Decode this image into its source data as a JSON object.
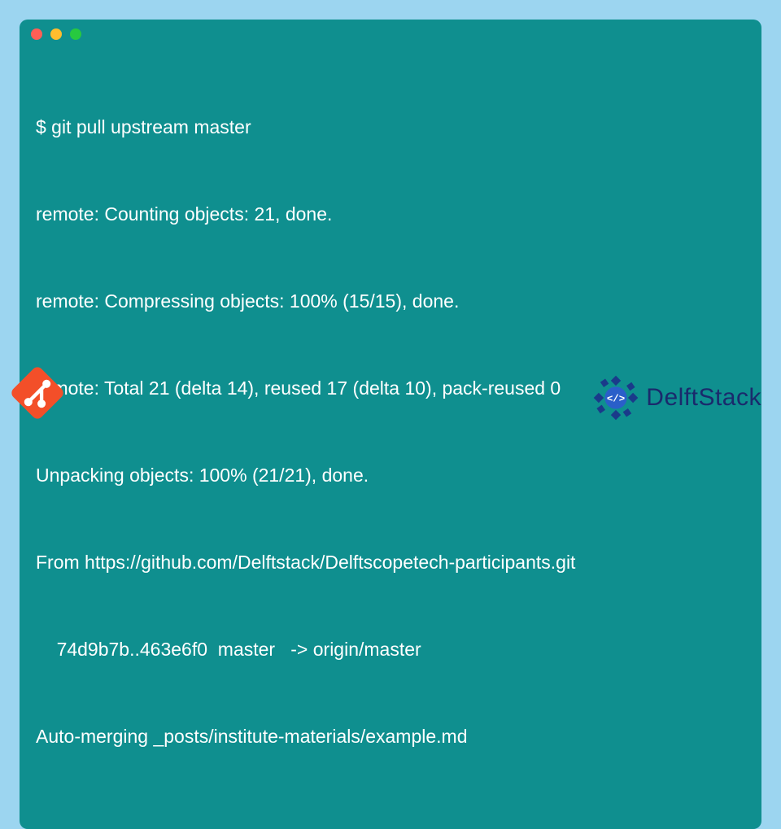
{
  "terminal": {
    "lines": [
      "$ git pull upstream master",
      "remote: Counting objects: 21, done.",
      "remote: Compressing objects: 100% (15/15), done.",
      "remote: Total 21 (delta 14), reused 17 (delta 10), pack-reused 0",
      "Unpacking objects: 100% (21/21), done.",
      "From https://github.com/Delftstack/Delftscopetech-participants.git",
      "    74d9b7b..463e6f0  master   -> origin/master",
      "Auto-merging _posts/institute-materials/example.md"
    ]
  },
  "branding": {
    "name": "DelftStack"
  },
  "colors": {
    "page_bg": "#9cd5f0",
    "terminal_bg": "#0f8f8f",
    "terminal_fg": "#ffffff",
    "git_orange": "#f34f29",
    "delft_blue": "#1a2a6c"
  }
}
